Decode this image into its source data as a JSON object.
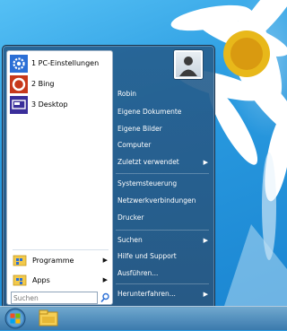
{
  "start_menu": {
    "pinned": [
      {
        "label": "1 PC-Einstellungen",
        "icon": "gear-icon"
      },
      {
        "label": "2 Bing",
        "icon": "bing-icon"
      },
      {
        "label": "3 Desktop",
        "icon": "desktop-icon"
      }
    ],
    "programs_label": "Programme",
    "apps_label": "Apps",
    "search_placeholder": "Suchen",
    "right": {
      "user": "Robin",
      "documents": "Eigene Dokumente",
      "pictures": "Eigene Bilder",
      "computer": "Computer",
      "recent": "Zuletzt verwendet",
      "control_panel": "Systemsteuerung",
      "network": "Netzwerkverbindungen",
      "printers": "Drucker",
      "search": "Suchen",
      "help": "Hilfe und Support",
      "run": "Ausführen...",
      "shutdown": "Herunterfahren..."
    }
  },
  "colors": {
    "menu_bg": "#285a86",
    "wallpaper": "#2a9be0"
  }
}
